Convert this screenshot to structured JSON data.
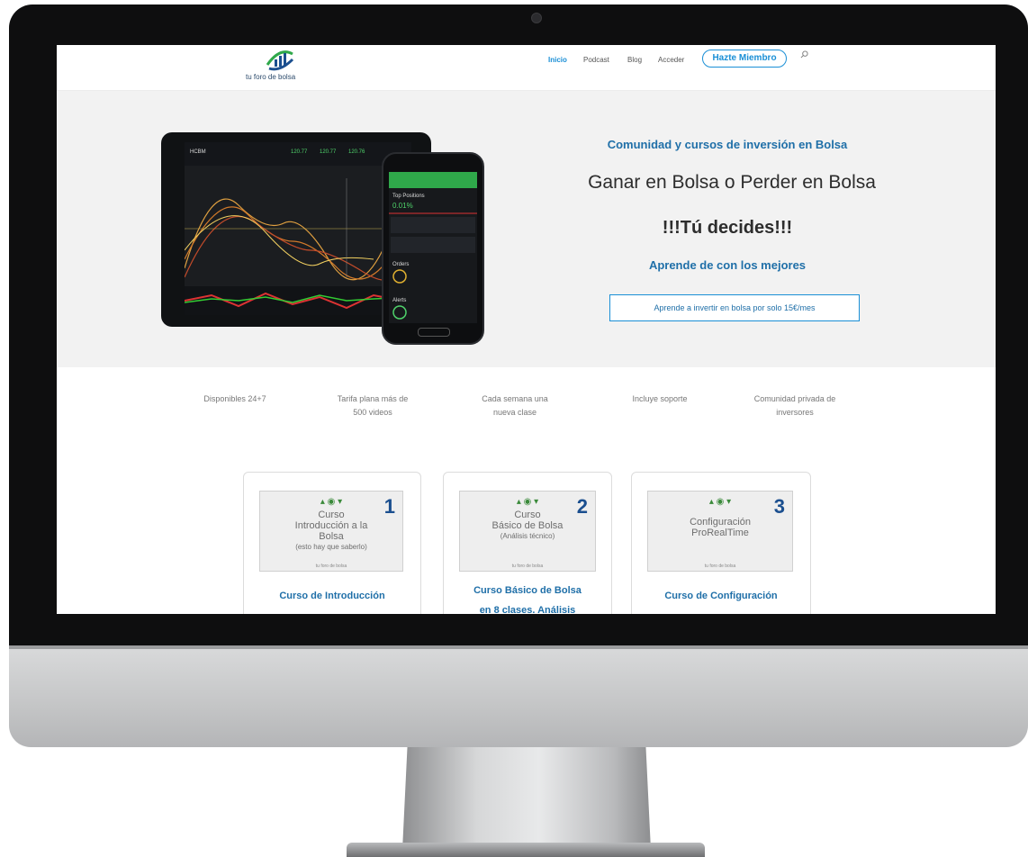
{
  "nav": {
    "logo_text": "tu foro de bolsa",
    "items": [
      "Inicio",
      "Podcast",
      "Blog",
      "Acceder"
    ],
    "cta": "Hazte Miembro"
  },
  "hero": {
    "tagline": "Comunidad y cursos de inversión en Bolsa",
    "title": "Ganar en Bolsa o Perder en Bolsa",
    "subtitle": "!!!Tú decides!!!",
    "lead": "Aprende de con los mejores",
    "button": "Aprende a invertir en bolsa por solo 15€/mes"
  },
  "features": [
    [
      "Disponibles 24+7",
      ""
    ],
    [
      "Tarifa plana más de",
      "500 videos"
    ],
    [
      "Cada semana una",
      "nueva clase"
    ],
    [
      "Incluye soporte",
      ""
    ],
    [
      "Comunidad privada de",
      "inversores"
    ]
  ],
  "cards": [
    {
      "number": "1",
      "thumb_lines": [
        "Curso",
        "Introducción a la",
        "Bolsa"
      ],
      "thumb_small": "(esto hay que saberlo)",
      "title": "Curso de Introducción"
    },
    {
      "number": "2",
      "thumb_lines": [
        "Curso",
        "Básico de Bolsa"
      ],
      "thumb_small": "(Análisis técnico)",
      "title": "Curso Básico de Bolsa",
      "title_2": "en 8 clases. Análisis"
    },
    {
      "number": "3",
      "thumb_lines": [
        "Configuración",
        "ProRealTime"
      ],
      "thumb_small": "",
      "title": "Curso de Configuración"
    }
  ],
  "thumb_footer": "tu foro de bolsa",
  "colors": {
    "accent": "#1a8fd6",
    "heading_blue": "#1f6fa8",
    "hero_bg": "#f2f2f2",
    "bezel": "#0e0e0f"
  }
}
